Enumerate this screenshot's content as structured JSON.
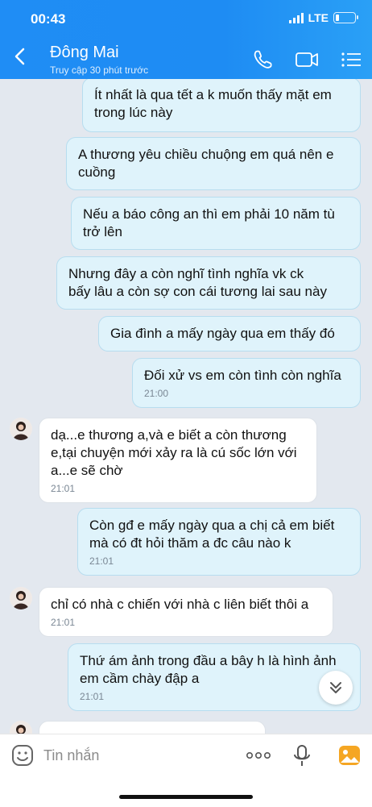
{
  "status_bar": {
    "time": "00:43",
    "network": "LTE"
  },
  "header": {
    "title": "Đông Mai",
    "subtitle": "Truy cập 30 phút trước"
  },
  "messages": [
    {
      "from": "me",
      "lines": [
        "Ít nhất là qua tết a k muốn thấy mặt em",
        "trong lúc này"
      ],
      "time": ""
    },
    {
      "from": "me",
      "lines": [
        "A thương yêu chiều chuộng em quá nên e",
        "cuồng"
      ],
      "time": ""
    },
    {
      "from": "me",
      "lines": [
        "Nếu a báo công an thì em phải 10 năm tù",
        "trở lên"
      ],
      "time": ""
    },
    {
      "from": "me",
      "lines": [
        "Nhưng đây a còn nghĩ tình nghĩa vk ck",
        "bấy lâu a còn sợ con cái tương lai sau này"
      ],
      "time": ""
    },
    {
      "from": "me",
      "lines": [
        "Gia đình a mấy ngày qua em thấy đó"
      ],
      "time": ""
    },
    {
      "from": "me",
      "lines": [
        "Đối xử vs em còn tình còn nghĩa"
      ],
      "time": "21:00"
    },
    {
      "from": "them",
      "lines": [
        "dạ...e thương a,và e biết a còn thương",
        "e,tại chuyện mới xảy ra là cú sốc lớn với",
        "a...e sẽ chờ"
      ],
      "time": "21:01"
    },
    {
      "from": "me",
      "lines": [
        "Còn gđ e mấy ngày qua a chị cả em biết",
        "mà có đt hỏi thăm a đc câu nào k"
      ],
      "time": "21:01"
    },
    {
      "from": "them",
      "lines": [
        "chỉ có nhà c chiến với nhà c liên biết thôi a"
      ],
      "time": "21:01"
    },
    {
      "from": "me",
      "lines": [
        "Thứ ám ảnh trong đầu a bây h là hình ảnh",
        "em cầm chày đập a"
      ],
      "time": "21:01"
    }
  ],
  "input": {
    "placeholder": "Tin nhắn"
  },
  "icons": {
    "back": "chevron-left-icon",
    "call": "phone-icon",
    "video": "video-camera-icon",
    "menu": "menu-icon",
    "emoji": "emoji-icon",
    "more": "more-dots-icon",
    "mic": "microphone-icon",
    "image": "image-icon",
    "scroll": "chevron-down-double-icon"
  },
  "colors": {
    "header": "#1e8cf3",
    "outgoing": "#dff3fb",
    "incoming": "#ffffff",
    "image_icon": "#f5a623"
  }
}
